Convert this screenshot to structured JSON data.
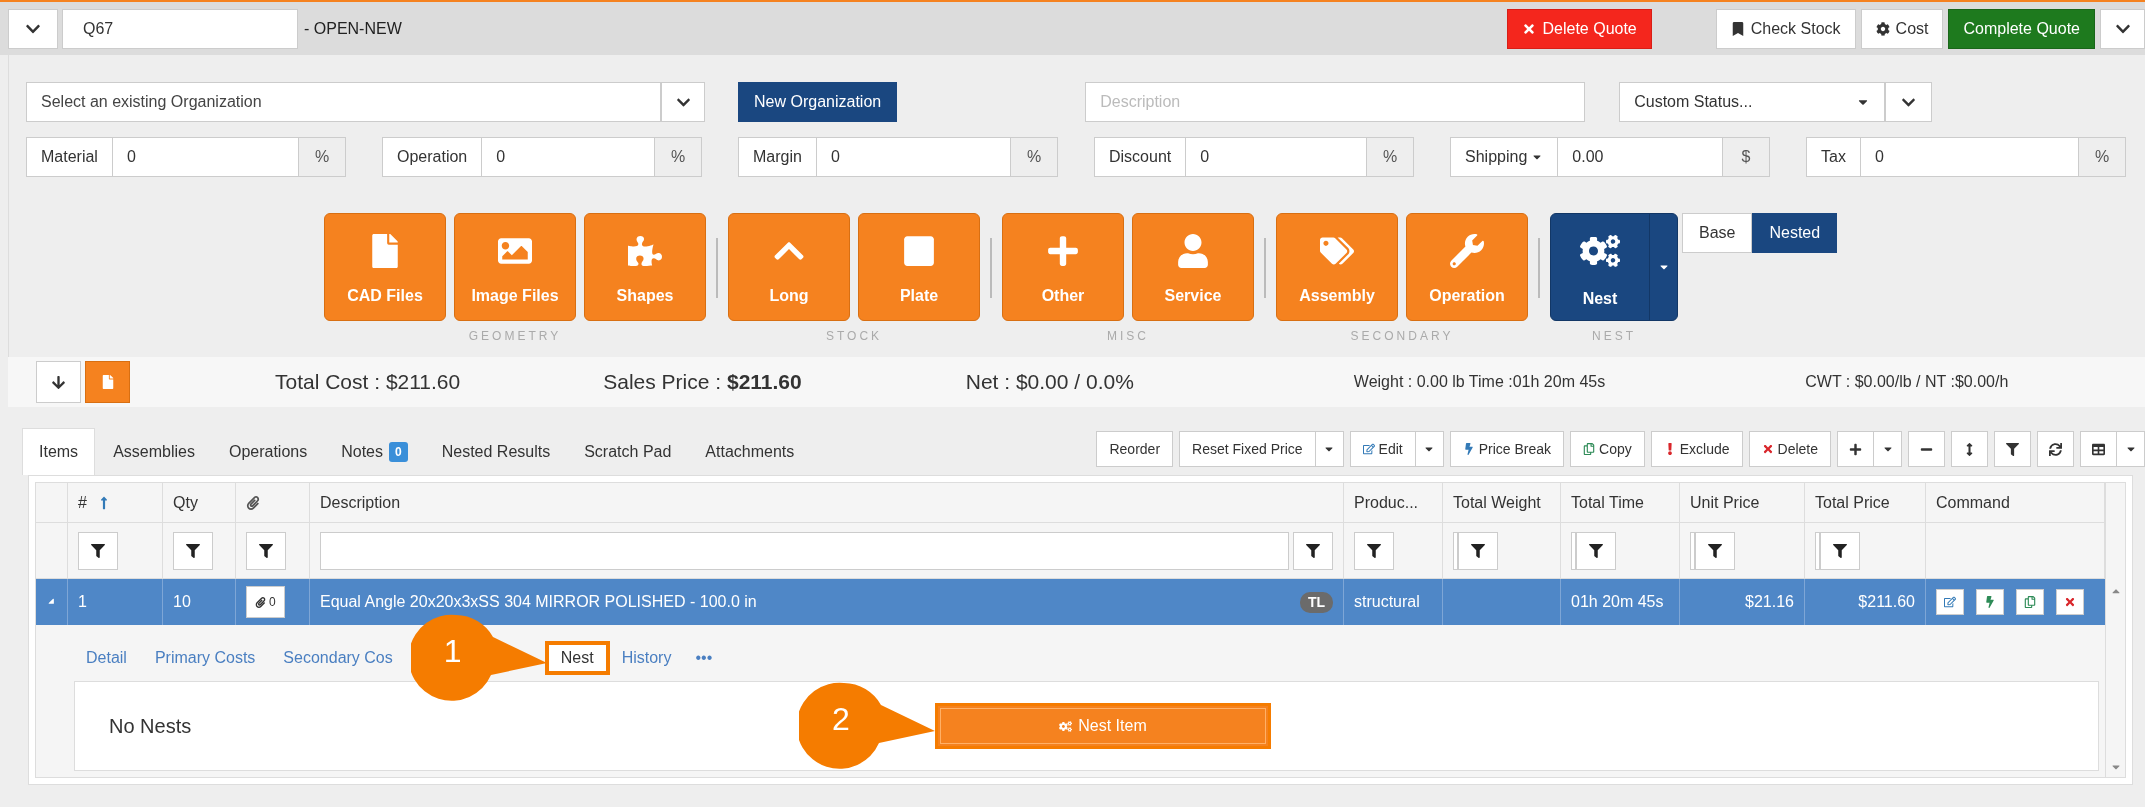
{
  "header": {
    "quote_number": "Q67",
    "status": "- OPEN-NEW",
    "actions": [
      {
        "label": "Delete Quote",
        "kind": "delete"
      },
      {
        "label": "Check Stock",
        "kind": "check_stock"
      },
      {
        "label": "Cost",
        "kind": "cost"
      },
      {
        "label": "Complete Quote",
        "kind": "complete"
      }
    ]
  },
  "organization": {
    "placeholder": "Select an existing Organization",
    "new_button": "New Organization"
  },
  "description": {
    "placeholder": "Description"
  },
  "custom_status": {
    "value": "Custom Status..."
  },
  "adjustments": [
    {
      "label": "Material",
      "value": "0",
      "unit": "%",
      "dropdown": false
    },
    {
      "label": "Operation",
      "value": "0",
      "unit": "%",
      "dropdown": false
    },
    {
      "label": "Margin",
      "value": "0",
      "unit": "%",
      "dropdown": false
    },
    {
      "label": "Discount",
      "value": "0",
      "unit": "%",
      "dropdown": false
    },
    {
      "label": "Shipping",
      "value": "0.00",
      "unit": "$",
      "dropdown": true
    },
    {
      "label": "Tax",
      "value": "0",
      "unit": "%",
      "dropdown": false
    }
  ],
  "toolbar": [
    {
      "label": "GEOMETRY",
      "buttons": [
        {
          "label": "CAD Files",
          "kind": "cad"
        },
        {
          "label": "Image Files",
          "kind": "image"
        },
        {
          "label": "Shapes",
          "kind": "shapes"
        }
      ]
    },
    {
      "label": "STOCK",
      "buttons": [
        {
          "label": "Long",
          "kind": "long"
        },
        {
          "label": "Plate",
          "kind": "plate"
        }
      ]
    },
    {
      "label": "MISC",
      "buttons": [
        {
          "label": "Other",
          "kind": "other"
        },
        {
          "label": "Service",
          "kind": "service"
        }
      ]
    },
    {
      "label": "SECONDARY",
      "buttons": [
        {
          "label": "Assembly",
          "kind": "assembly"
        },
        {
          "label": "Operation",
          "kind": "operation"
        }
      ]
    },
    {
      "label": "NEST",
      "buttons": [
        {
          "label": "Nest",
          "kind": "nest"
        }
      ]
    }
  ],
  "nest_mode": [
    {
      "label": "Base",
      "selected": false
    },
    {
      "label": "Nested",
      "selected": true
    }
  ],
  "summary": {
    "total_cost": "Total Cost : $211.60",
    "sales_price": "Sales Price : **$211.60**",
    "net": "Net : $0.00 / 0.0%",
    "weight_time": "Weight : 0.00 lb Time :01h 20m 45s",
    "cwt": "CWT : $0.00/lb / NT :$0.00/h"
  },
  "tabs": [
    {
      "label": "Items",
      "selected": true
    },
    {
      "label": "Assemblies",
      "selected": false
    },
    {
      "label": "Operations",
      "selected": false
    },
    {
      "label": "Notes",
      "badge": "0",
      "selected": false
    },
    {
      "label": "Nested Results",
      "selected": false
    },
    {
      "label": "Scratch Pad",
      "selected": false
    },
    {
      "label": "Attachments",
      "selected": false
    }
  ],
  "grid_actions": [
    {
      "label": "Reorder",
      "kind": "plain",
      "dropdown": false
    },
    {
      "label": "Reset Fixed Price",
      "kind": "plain",
      "dropdown": true
    },
    {
      "label": "Edit",
      "kind": "edit",
      "dropdown": true
    },
    {
      "label": "Price Break",
      "kind": "bolt",
      "dropdown": false
    },
    {
      "label": "Copy",
      "kind": "copy",
      "dropdown": false
    },
    {
      "label": "Exclude",
      "kind": "exclude",
      "dropdown": false
    },
    {
      "label": "Delete",
      "kind": "delete",
      "dropdown": false
    }
  ],
  "grid_tools": [
    {
      "kind": "add",
      "dropdown": true
    },
    {
      "kind": "remove",
      "dropdown": false
    },
    {
      "kind": "resize",
      "dropdown": false
    },
    {
      "kind": "filter",
      "dropdown": false
    },
    {
      "kind": "refresh",
      "dropdown": false
    },
    {
      "kind": "grid",
      "dropdown": true
    }
  ],
  "table": {
    "columns": [
      {
        "label": "#",
        "sorted_ascending": true,
        "filter": {
          "kind": "button"
        }
      },
      {
        "label": "Qty",
        "filter": {
          "kind": "button"
        }
      },
      {
        "kind": "attachment",
        "filter": {
          "kind": "button"
        }
      },
      {
        "label": "Description",
        "filter": {
          "kind": "input"
        }
      },
      {
        "label": "Produc...",
        "filter": {
          "kind": "button"
        }
      },
      {
        "label": "Total Weight",
        "filter": {
          "kind": "split"
        }
      },
      {
        "label": "Total Time",
        "filter": {
          "kind": "split"
        }
      },
      {
        "label": "Unit Price",
        "filter": {
          "kind": "split"
        }
      },
      {
        "label": "Total Price",
        "filter": {
          "kind": "split"
        }
      },
      {
        "label": "Command"
      }
    ],
    "rows": [
      {
        "expanded": true,
        "selected": true,
        "number": "1",
        "qty": "10",
        "attachments": "0",
        "description": "Equal Angle 20x20x3xSS 304 MIRROR POLISHED - 100.0 in",
        "tag": "TL",
        "product": "structural",
        "total_time": "01h 20m 45s",
        "unit_price": "$21.16",
        "total_price": "$211.60",
        "commands": [
          {
            "kind": "edit"
          },
          {
            "kind": "bolt"
          },
          {
            "kind": "copy"
          },
          {
            "kind": "delete"
          }
        ]
      }
    ]
  },
  "detail": {
    "tabs": [
      {
        "label": "Detail",
        "selected": false,
        "highlighted": false
      },
      {
        "label": "Primary Costs",
        "selected": false,
        "highlighted": false
      },
      {
        "label": "Secondary Cos",
        "selected": false,
        "highlighted": false
      },
      {
        "label": "Nest",
        "selected": true,
        "highlighted": true
      },
      {
        "label": "History",
        "selected": false,
        "highlighted": false
      },
      {
        "label": "•••",
        "selected": false,
        "highlighted": false
      }
    ],
    "message": "No Nests",
    "button": {
      "label": "Nest Item",
      "highlighted": true
    }
  },
  "callouts": [
    {
      "label": "1"
    },
    {
      "label": "2"
    }
  ]
}
